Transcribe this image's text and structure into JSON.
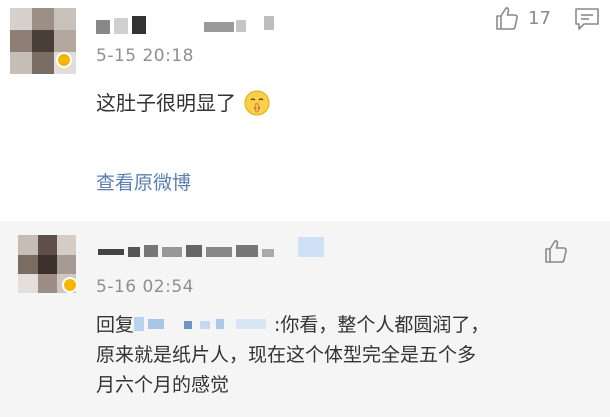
{
  "comments": [
    {
      "time": "5-15 20:18",
      "text": "这肚子很明显了",
      "emoji": "shush-face-emoji",
      "like_count": "17",
      "link": "查看原微博"
    },
    {
      "time": "5-16 02:54",
      "reply_prefix": "回复",
      "reply_lines": [
        ":你看，整个人都圆润了，",
        "原来就是纸片人，现在这个体型完全是五个多",
        "月六个月的感觉"
      ]
    }
  ],
  "icons": {
    "like": "thumbs-up-icon",
    "comment": "comment-icon",
    "verified": "verified-badge-icon"
  },
  "colors": {
    "link": "#5b7fb3",
    "time": "#8f8f8f",
    "reply_bg": "#f5f5f5",
    "badge": "#f7b500"
  }
}
